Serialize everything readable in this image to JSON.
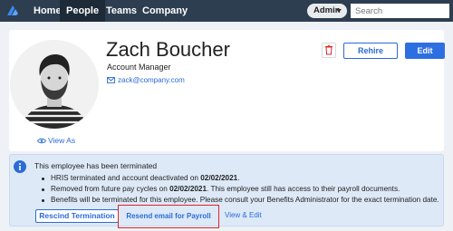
{
  "nav": {
    "items": [
      {
        "label": "Home"
      },
      {
        "label": "People"
      },
      {
        "label": "Teams"
      },
      {
        "label": "Company"
      }
    ],
    "admin_label": "Admin",
    "search_placeholder": "Search"
  },
  "profile": {
    "name": "Zach Boucher",
    "title": "Account Manager",
    "email": "zack@company.com",
    "view_as": "View As",
    "rehire_label": "Rehire",
    "edit_label": "Edit"
  },
  "alert": {
    "title": "This employee has been terminated",
    "bullets": [
      {
        "pre": "HRIS terminated and account deactivated on ",
        "date": "02/02/2021",
        "post": "."
      },
      {
        "pre": "Removed from future pay cycles on ",
        "date": "02/02/2021",
        "post": ". This employee still has access to their payroll documents."
      },
      {
        "pre": "Benefits will be terminated for this employee.  Please consult your Benefits Administrator for the exact termination date.",
        "date": "",
        "post": ""
      }
    ],
    "rescind_label": "Rescind Termination",
    "resend_label": "Resend email for Payroll access",
    "view_edit_label": "View & Edit"
  },
  "colors": {
    "nav_bg": "#2d3e50",
    "accent": "#2b6bd8",
    "alert_bg": "#dde9f7",
    "highlight": "#e0252a"
  }
}
